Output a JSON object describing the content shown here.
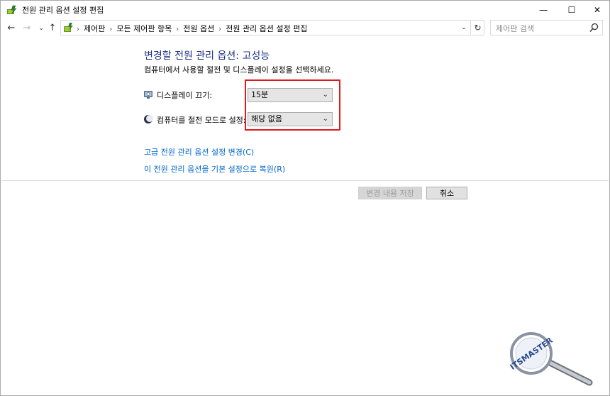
{
  "window": {
    "title": "전원 관리 옵션 설정 편집",
    "minimize_glyph": "—",
    "maximize_glyph": "☐",
    "close_glyph": "✕"
  },
  "nav": {
    "back_glyph": "←",
    "forward_glyph": "→",
    "recent_glyph": "⌄",
    "up_glyph": "↑",
    "refresh_glyph": "↻",
    "dropdown_glyph": "⌄",
    "breadcrumbs": [
      "제어판",
      "모든 제어판 항목",
      "전원 옵션",
      "전원 관리 옵션 설정 편집"
    ],
    "breadcrumb_sep": "›",
    "search_placeholder": "제어판 검색"
  },
  "main": {
    "heading": "변경할 전원 관리 옵션: 고성능",
    "subheading": "컴퓨터에서 사용할 절전 및 디스플레이 설정을 선택하세요.",
    "display_off_label": "디스플레이 끄기:",
    "display_off_value": "15분",
    "sleep_label": "컴퓨터를 절전 모드로 설정:",
    "sleep_value": "해당 없음",
    "advanced_link": "고급 전원 관리 옵션 설정 변경(C)",
    "restore_link": "이 전원 관리 옵션을 기본 설정으로 복원(R)"
  },
  "buttons": {
    "save": "변경 내용 저장",
    "cancel": "취소"
  },
  "watermark": {
    "text": "ITSMASTER"
  },
  "colors": {
    "heading": "#1e3287",
    "link": "#0066cc",
    "highlight_box": "#e0191d"
  }
}
